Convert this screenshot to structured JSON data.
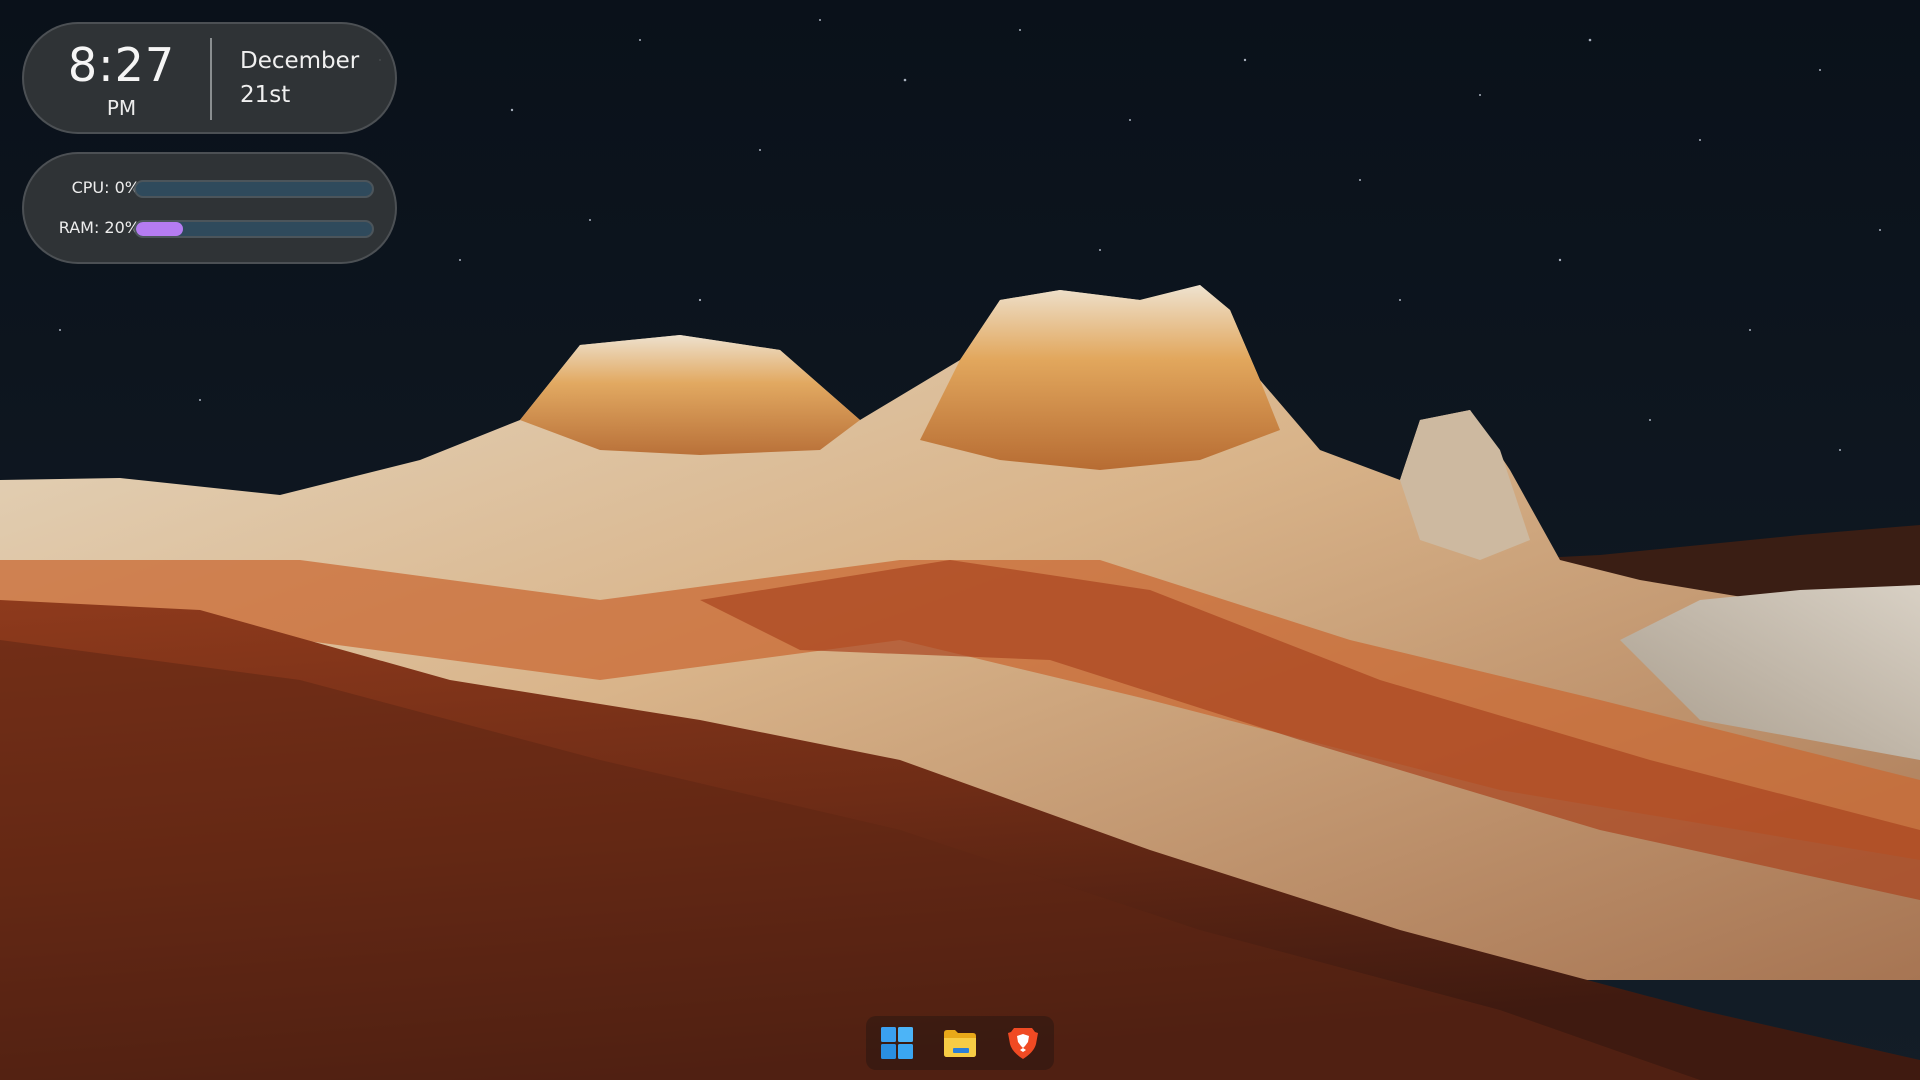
{
  "desktop": {
    "wallpaper": {
      "name": "desert-rock-night-wallpaper",
      "sky_color": "#0d1520",
      "rock_colors": [
        "#d9cbb5",
        "#c97b3e",
        "#8a3a1c",
        "#5e2716"
      ]
    }
  },
  "clock_widget": {
    "time": "8:27",
    "ampm": "PM",
    "month": "December",
    "day": "21st"
  },
  "stats_widget": {
    "cpu": {
      "label": "CPU: 0%",
      "percent": 0,
      "color": "#2f4a5c"
    },
    "ram": {
      "label": "RAM: 20%",
      "percent": 20,
      "color": "#b57cf2"
    }
  },
  "taskbar": {
    "icons": [
      {
        "name": "windows-start-icon",
        "color": "#3aa0f0"
      },
      {
        "name": "file-explorer-icon",
        "color": "#f5c33b"
      },
      {
        "name": "brave-browser-icon",
        "color": "#f04a23"
      }
    ]
  }
}
